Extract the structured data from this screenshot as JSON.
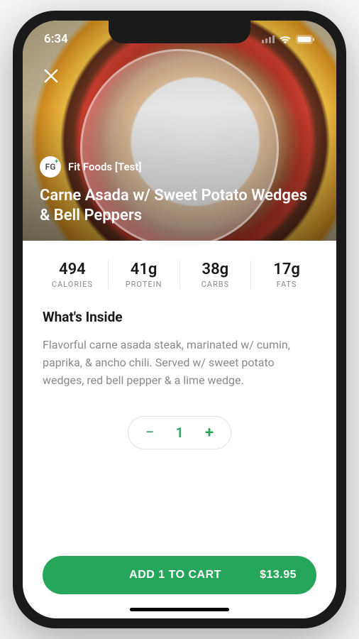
{
  "status": {
    "time": "6:34"
  },
  "hero": {
    "vendor_logo_text": "FG",
    "vendor_name": "Fit Foods [Test]",
    "dish_title": "Carne Asada w/ Sweet Potato Wedges & Bell Peppers"
  },
  "nutrition": [
    {
      "value": "494",
      "label": "CALORIES"
    },
    {
      "value": "41g",
      "label": "PROTEIN"
    },
    {
      "value": "38g",
      "label": "CARBS"
    },
    {
      "value": "17g",
      "label": "FATS"
    }
  ],
  "section": {
    "title": "What's Inside",
    "description": "Flavorful carne asada steak, marinated w/ cumin, paprika, & ancho chili. Served w/ sweet potato wedges, red bell pepper & a lime wedge."
  },
  "stepper": {
    "minus": "−",
    "value": "1",
    "plus": "+"
  },
  "cart": {
    "label": "ADD 1 TO CART",
    "price": "$13.95"
  }
}
